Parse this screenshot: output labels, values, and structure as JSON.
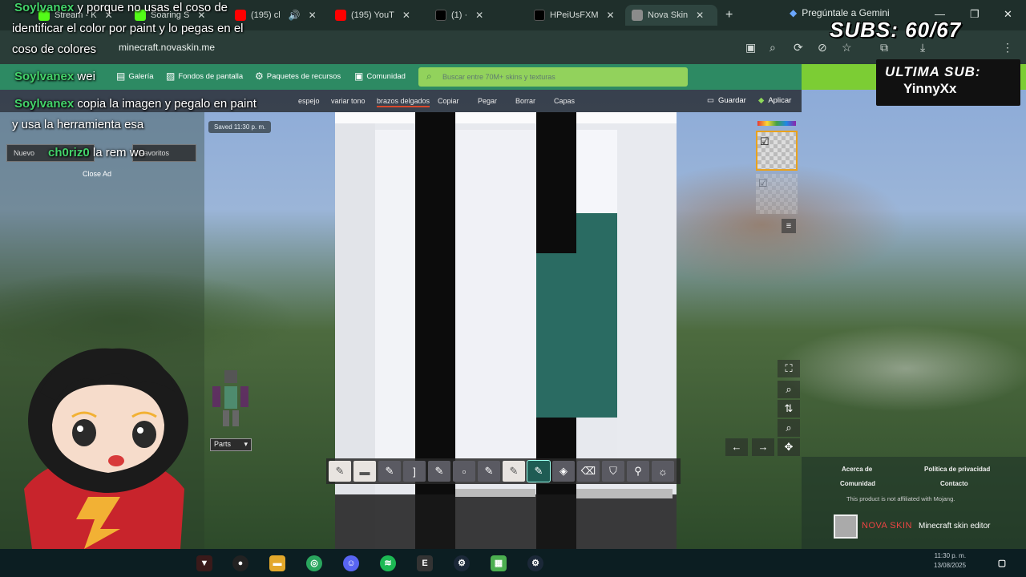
{
  "browser": {
    "tabs": [
      {
        "label": "Stream - K",
        "fav_color": "#53fc18"
      },
      {
        "label": "Soaring S",
        "fav_color": "#53fc18"
      },
      {
        "label": "(195) cl",
        "fav_color": "#ff0000"
      },
      {
        "label": "(195) YouT",
        "fav_color": "#ff0000"
      },
      {
        "label": "(1) ·",
        "fav_color": "#000000"
      },
      {
        "label": "HPeiUsFXM",
        "fav_color": "#000000"
      },
      {
        "label": "Nova Skin",
        "fav_color": "#8b8b8b"
      }
    ],
    "gemini_label": "Pregúntale a Gemini",
    "url": "minecraft.novaskin.me"
  },
  "site_nav": {
    "items": [
      "Galería",
      "Fondos de pantalla",
      "Paquetes de recursos",
      "Comunidad"
    ],
    "search_placeholder": "Buscar entre 70M+ skins y texturas"
  },
  "toolbar": {
    "items": [
      "espejo",
      "variar tono",
      "brazos delgados",
      "Copiar",
      "Pegar",
      "Borrar",
      "Capas"
    ],
    "save_label": "Guardar",
    "apply_label": "Aplicar",
    "saved_badge": "Saved 11:30 p. m."
  },
  "left_panel": {
    "close_ad": "Close Ad",
    "new_button": "Nuevo",
    "favorites_button": "Favoritos",
    "parts_label": "Parts"
  },
  "footer": {
    "about": "Acerca de",
    "community": "Comunidad",
    "privacy": "Política de privacidad",
    "contact": "Contacto",
    "disclaimer": "This product is not affiliated with Mojang.",
    "brand": "NOVA SKIN",
    "brand_sub": "Minecraft skin editor"
  },
  "taskbar": {
    "time": "11:30 p. m.",
    "date": "13/08/2025"
  },
  "stream": {
    "chat": [
      {
        "user": "Soylvanex",
        "text": "y porque no usas el coso de"
      },
      {
        "user": "",
        "text": "identificar el color por paint y lo pegas en el"
      },
      {
        "user": "",
        "text": "coso de colores"
      },
      {
        "user": "Soylvanex",
        "text": "wei"
      },
      {
        "user": "Soylvanex",
        "text": "copia la imagen y pegalo en paint"
      },
      {
        "user": "",
        "text": "y usa la herramienta esa"
      },
      {
        "user": "ch0riz0",
        "text": "la rem wo"
      }
    ],
    "subs": "SUBS: 60/67",
    "last_sub_title": "ULTIMA SUB:",
    "last_sub_name": "YinnyXx"
  },
  "colors": {
    "nav_green": "#2d8a63",
    "accent_teal": "#2a6b62",
    "chat_user": "#43d36a"
  }
}
